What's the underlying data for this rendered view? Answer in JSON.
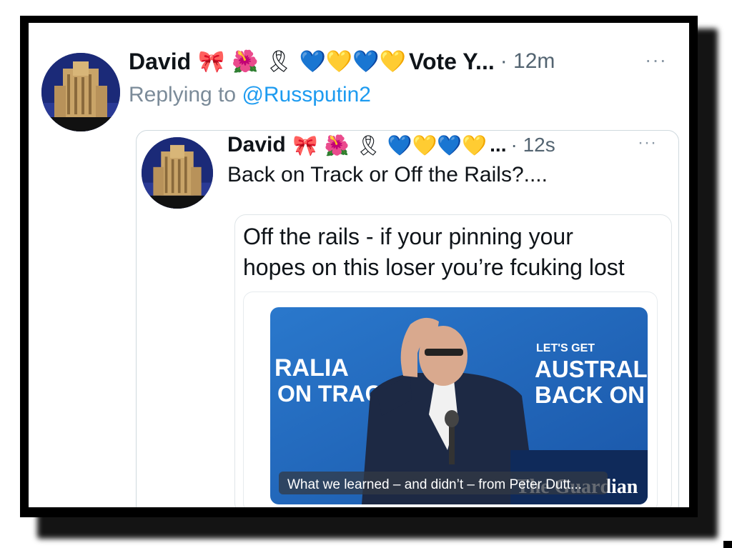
{
  "tweet": {
    "author_name": "David",
    "author_emojis": "🎀 🌺 🎗 💙💛💙💛",
    "author_suffix": "Vote Y...",
    "time": "· 12m",
    "more": "···",
    "replying_to_label": "Replying to",
    "replying_to_handle": "@Russputin2"
  },
  "quoted": {
    "author_name": "David",
    "author_emojis": "🎀 🌺 🎗 💙💛💙💛",
    "author_suffix": "...",
    "time": "· 12s",
    "more": "···",
    "text": "Back on Track  or Off the Rails?...."
  },
  "nested": {
    "text_line1": "Off the rails - if your pinning your",
    "text_line2": "hopes on this loser you’re fcuking lost"
  },
  "media": {
    "banner_left_line1": "RALIA",
    "banner_left_line2": "ON TRAC",
    "banner_right_small": "LET'S GET",
    "banner_right_line1": "AUSTRAL",
    "banner_right_line2": "BACK ON",
    "publisher": "The Guardian",
    "caption": "What we learned – and didn’t – from Peter Dutt..."
  },
  "colors": {
    "accent": "#1d9bf0",
    "stage_blue": "#1f64b8",
    "frame": "#000000"
  }
}
